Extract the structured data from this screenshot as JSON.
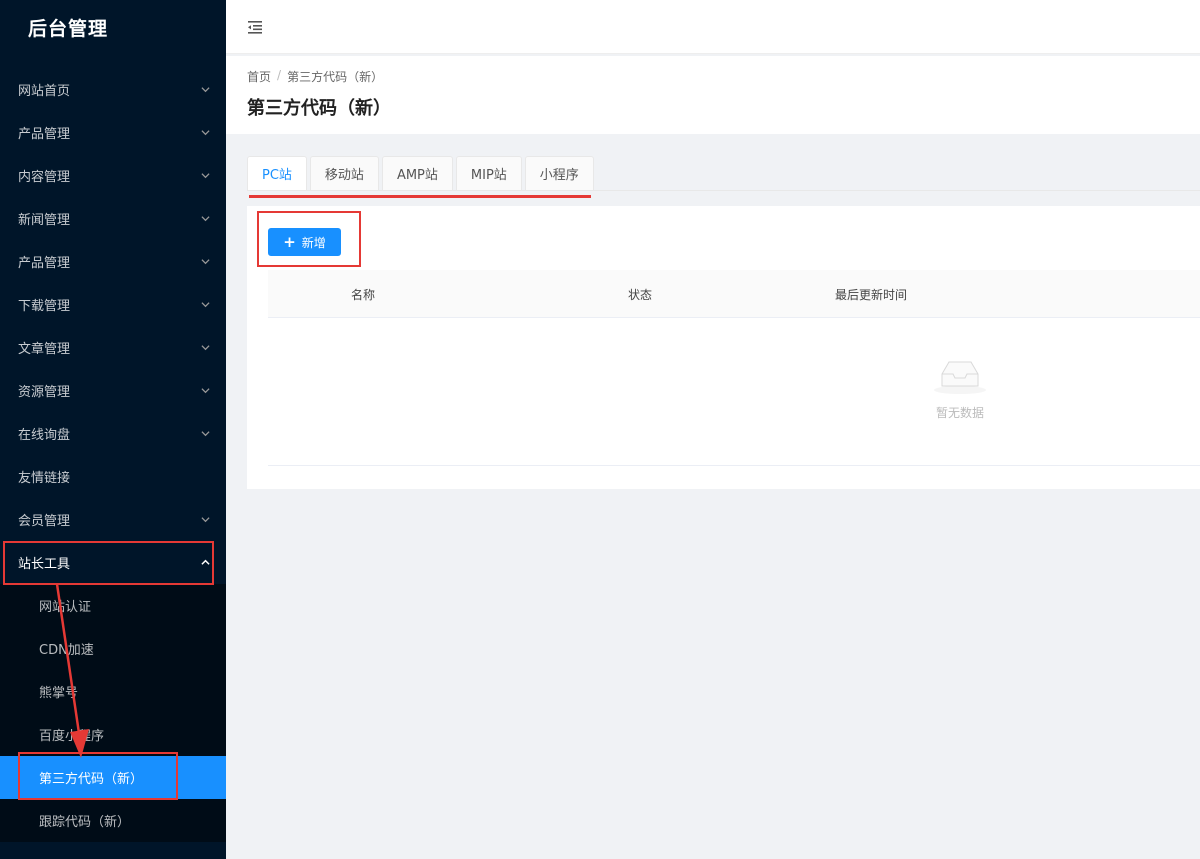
{
  "app": {
    "title": "后台管理"
  },
  "sidebar": {
    "items": [
      {
        "label": "网站首页",
        "has_arrow": true
      },
      {
        "label": "产品管理",
        "has_arrow": true
      },
      {
        "label": "内容管理",
        "has_arrow": true
      },
      {
        "label": "新闻管理",
        "has_arrow": true
      },
      {
        "label": "产品管理",
        "has_arrow": true
      },
      {
        "label": "下载管理",
        "has_arrow": true
      },
      {
        "label": "文章管理",
        "has_arrow": true
      },
      {
        "label": "资源管理",
        "has_arrow": true
      },
      {
        "label": "在线询盘",
        "has_arrow": true
      },
      {
        "label": "友情链接",
        "has_arrow": false
      },
      {
        "label": "会员管理",
        "has_arrow": true
      }
    ],
    "open_item": {
      "label": "站长工具",
      "children": [
        {
          "label": "网站认证"
        },
        {
          "label": "CDN加速"
        },
        {
          "label": "熊掌号"
        },
        {
          "label": "百度小程序"
        },
        {
          "label": "第三方代码（新）",
          "active": true
        },
        {
          "label": "跟踪代码（新）"
        }
      ]
    }
  },
  "breadcrumb": {
    "home": "首页",
    "separator": "/",
    "current": "第三方代码（新）"
  },
  "page": {
    "title": "第三方代码（新）"
  },
  "tabs": [
    {
      "label": "PC站",
      "active": true
    },
    {
      "label": "移动站"
    },
    {
      "label": "AMP站"
    },
    {
      "label": "MIP站"
    },
    {
      "label": "小程序"
    }
  ],
  "toolbar": {
    "add_label": "新增"
  },
  "table": {
    "columns": [
      "名称",
      "状态",
      "最后更新时间"
    ],
    "empty_text": "暂无数据"
  },
  "colors": {
    "sidebar_bg": "#001529",
    "accent": "#1890ff",
    "annotation": "#e53935"
  }
}
